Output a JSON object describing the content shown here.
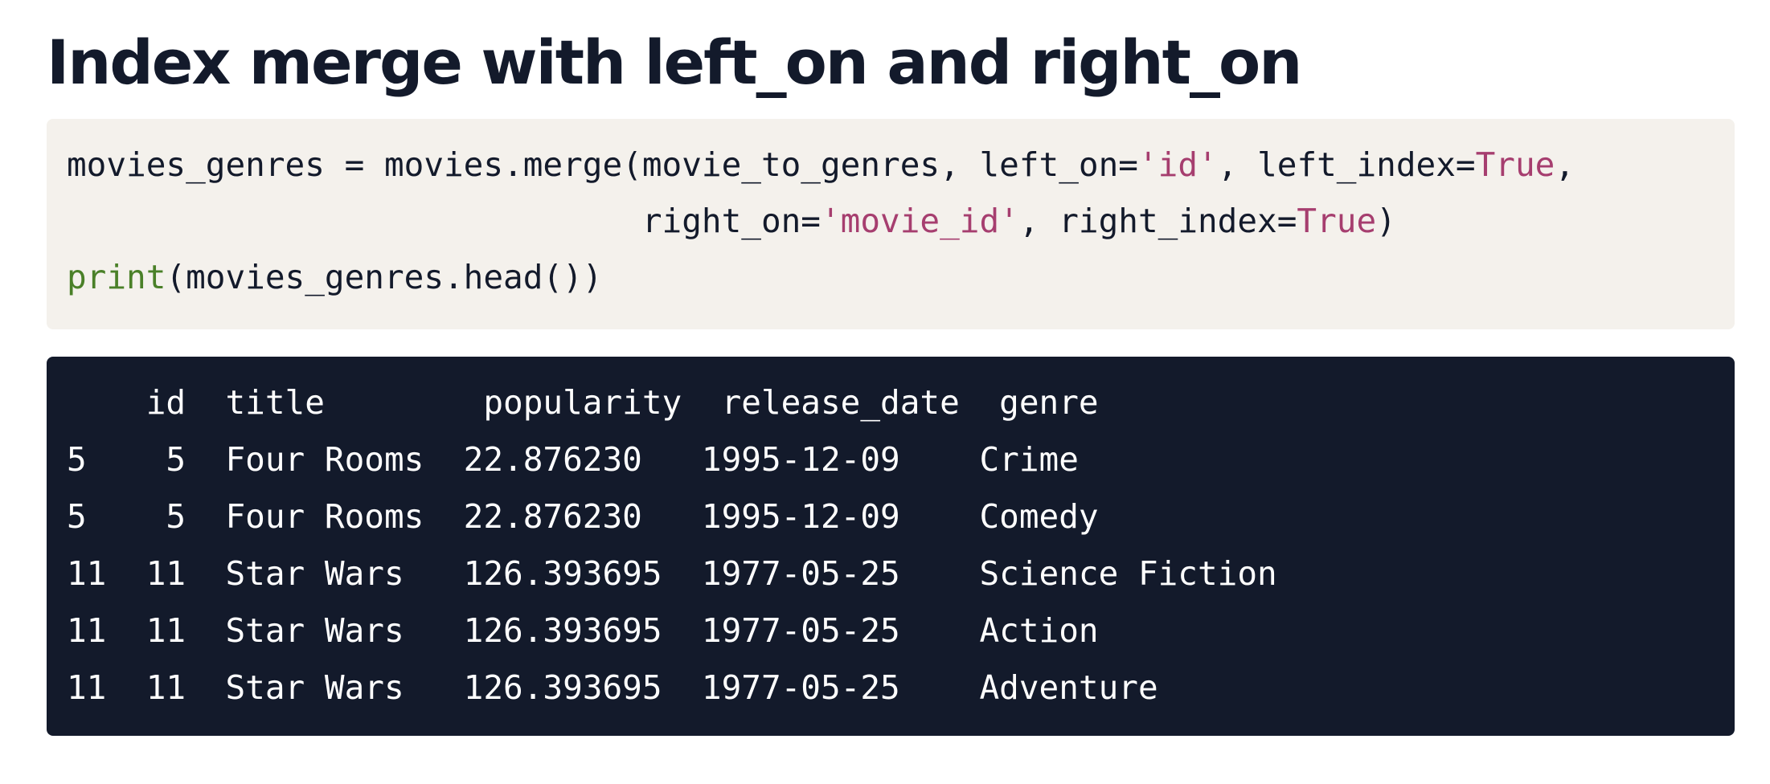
{
  "title": "Index merge with left_on and right_on",
  "code": {
    "line1": {
      "prefix": "movies_genres = movies.merge(movie_to_genres, left_on=",
      "str1": "'id'",
      "mid": ", left_index=",
      "kw1": "True",
      "suffix": ","
    },
    "line2": {
      "indent": "                             right_on=",
      "str1": "'movie_id'",
      "mid": ", right_index=",
      "kw1": "True",
      "suffix": ")"
    },
    "line3": {
      "fn": "print",
      "rest": "(movies_genres.head())"
    }
  },
  "output": {
    "header": "    id  title        popularity  release_date  genre",
    "rows": [
      "5    5  Four Rooms  22.876230   1995-12-09    Crime",
      "5    5  Four Rooms  22.876230   1995-12-09    Comedy",
      "11  11  Star Wars   126.393695  1977-05-25    Science Fiction",
      "11  11  Star Wars   126.393695  1977-05-25    Action",
      "11  11  Star Wars   126.393695  1977-05-25    Adventure"
    ]
  }
}
